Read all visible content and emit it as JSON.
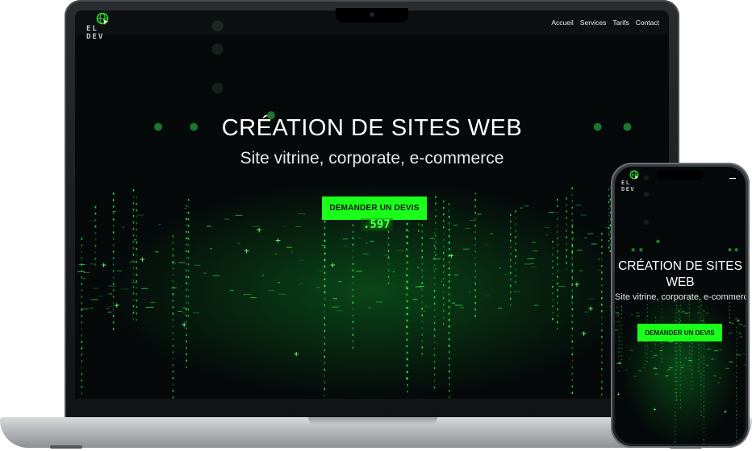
{
  "site": {
    "logo_text": "EL DEV",
    "nav": [
      "Accueil",
      "Services",
      "Tarifs",
      "Contact"
    ],
    "hero_title": "CRÉATION DE SITES WEB",
    "hero_subtitle": "Site vitrine, corporate, e-commerce",
    "cta_label": "DEMANDER UN DEVIS",
    "counter": ".597"
  },
  "phone": {
    "logo_text": "EL DEV",
    "title_line1": "CRÉATION DE SITES",
    "title_line2": "WEB",
    "subtitle": "Site vitrine, corporate, e-commerce",
    "cta_label": "DEMANDER UN DEVIS"
  },
  "colors": {
    "accent": "#1aff1a",
    "background": "#05090a",
    "text": "#ffffff"
  },
  "icons": [
    "globe-icon",
    "menu-icon"
  ]
}
